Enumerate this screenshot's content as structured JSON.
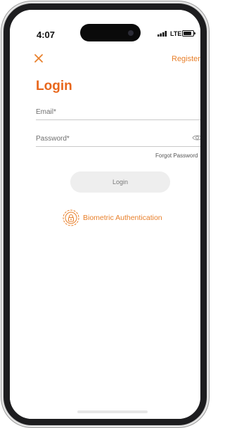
{
  "status_bar": {
    "time": "4:07",
    "network": "LTE"
  },
  "header": {
    "register_label": "Register"
  },
  "login": {
    "title": "Login",
    "email_placeholder": "Email*",
    "email_value": "",
    "password_placeholder": "Password*",
    "password_value": "",
    "forgot_password_label": "Forgot Password",
    "login_button_label": "Login",
    "biometric_label": "Biometric Authentication"
  },
  "icons": {
    "close": "close-icon",
    "password_visibility": "eye-icon",
    "biometric": "fingerprint-lock-icon"
  },
  "colors": {
    "accent": "#e8802c",
    "title": "#e8671c",
    "login_button_bg": "#eeeeee",
    "login_button_text": "#7a7a7a",
    "underline": "#c9c9c9"
  }
}
